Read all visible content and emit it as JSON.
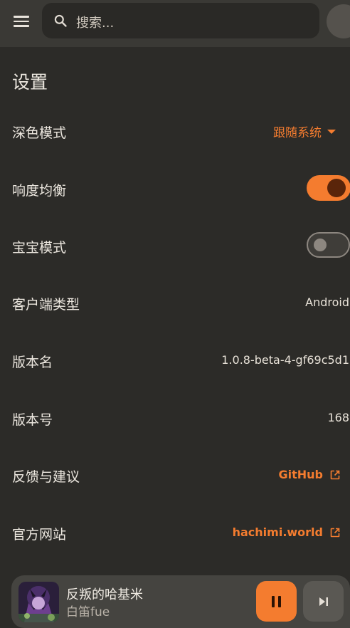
{
  "header": {
    "search_placeholder": "搜索..."
  },
  "page": {
    "title": "设置"
  },
  "settings": {
    "dark_mode": {
      "label": "深色模式",
      "value": "跟随系统"
    },
    "loudness_eq": {
      "label": "响度均衡",
      "enabled": true
    },
    "baby_mode": {
      "label": "宝宝模式",
      "enabled": false
    },
    "client_type": {
      "label": "客户端类型",
      "value": "Android"
    },
    "version_name": {
      "label": "版本名",
      "value": "1.0.8-beta-4-gf69c5d1"
    },
    "version_code": {
      "label": "版本号",
      "value": "168"
    },
    "feedback": {
      "label": "反馈与建议",
      "link": "GitHub"
    },
    "website": {
      "label": "官方网站",
      "link": "hachimi.world"
    }
  },
  "player": {
    "title": "反叛的哈基米",
    "artist": "白笛fue"
  },
  "colors": {
    "accent": "#f47c2f",
    "background": "#2c2b28",
    "topbar": "#3a3935"
  },
  "icons": {
    "menu": "menu-icon",
    "search": "search-icon",
    "dropdown": "caret-down-icon",
    "external": "external-link-icon",
    "pause": "pause-icon",
    "next": "skip-next-icon"
  }
}
